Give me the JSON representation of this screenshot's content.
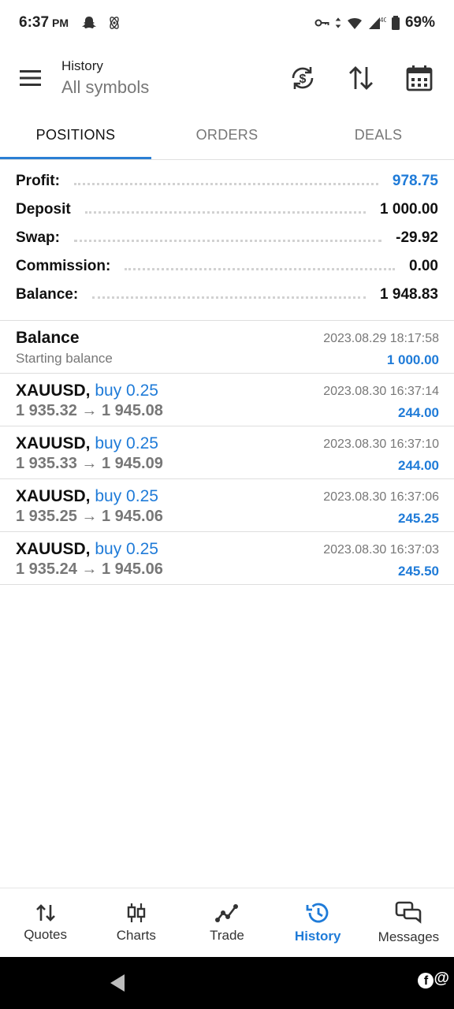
{
  "status_bar": {
    "time": "6:37",
    "ampm": "PM",
    "network": "4G",
    "battery": "69%"
  },
  "toolbar": {
    "title": "History",
    "subtitle": "All symbols",
    "icons": [
      "menu-icon",
      "currency-sync-icon",
      "sort-arrows-icon",
      "calendar-icon"
    ]
  },
  "tabs": [
    {
      "label": "POSITIONS",
      "active": true
    },
    {
      "label": "ORDERS",
      "active": false
    },
    {
      "label": "DEALS",
      "active": false
    }
  ],
  "summary": [
    {
      "label": "Profit:",
      "value": "978.75",
      "accent": true
    },
    {
      "label": "Deposit",
      "value": "1 000.00",
      "accent": false
    },
    {
      "label": "Swap:",
      "value": "-29.92",
      "accent": false
    },
    {
      "label": "Commission:",
      "value": "0.00",
      "accent": false
    },
    {
      "label": "Balance:",
      "value": "1 948.83",
      "accent": false
    }
  ],
  "balance_entry": {
    "title": "Balance",
    "subtitle": "Starting balance",
    "time": "2023.08.29 18:17:58",
    "amount": "1 000.00"
  },
  "deals": [
    {
      "symbol": "XAUUSD,",
      "side": "buy 0.25",
      "prices": "1 935.32 → 1 945.08",
      "time": "2023.08.30 16:37:14",
      "profit": "244.00"
    },
    {
      "symbol": "XAUUSD,",
      "side": "buy 0.25",
      "prices": "1 935.33 → 1 945.09",
      "time": "2023.08.30 16:37:10",
      "profit": "244.00"
    },
    {
      "symbol": "XAUUSD,",
      "side": "buy 0.25",
      "prices": "1 935.25 → 1 945.06",
      "time": "2023.08.30 16:37:06",
      "profit": "245.25"
    },
    {
      "symbol": "XAUUSD,",
      "side": "buy 0.25",
      "prices": "1 935.24 → 1 945.06",
      "time": "2023.08.30 16:37:03",
      "profit": "245.50"
    }
  ],
  "bottom_nav": [
    {
      "label": "Quotes",
      "icon": "quotes-arrows-icon",
      "active": false
    },
    {
      "label": "Charts",
      "icon": "candlestick-icon",
      "active": false
    },
    {
      "label": "Trade",
      "icon": "trade-line-icon",
      "active": false
    },
    {
      "label": "History",
      "icon": "history-clock-icon",
      "active": true
    },
    {
      "label": "Messages",
      "icon": "messages-icon",
      "active": false
    }
  ],
  "watermark": "@",
  "colors": {
    "accent": "#1f7bd8",
    "tab_indicator": "#2a7fd4",
    "muted_text": "#777777"
  }
}
